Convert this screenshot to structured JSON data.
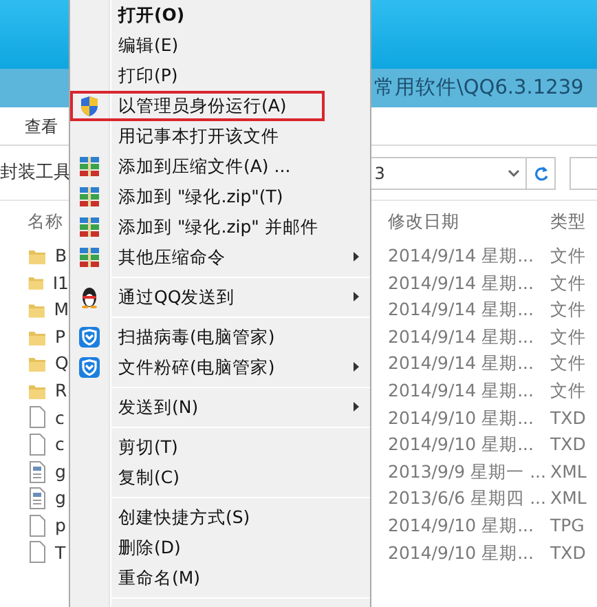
{
  "explorer": {
    "address": "常用软件\\QQ6.3.1239",
    "ribbon_tab": "查看",
    "ribbon_group": "封装工具",
    "path_box": "3",
    "columns": [
      "名称",
      "修改日期",
      "类型"
    ],
    "rows": [
      {
        "name": "B",
        "kind": "folder",
        "date": "2014/9/14 星期...",
        "type": "文件"
      },
      {
        "name": "I1",
        "kind": "folder",
        "date": "2014/9/14 星期...",
        "type": "文件"
      },
      {
        "name": "M",
        "kind": "folder",
        "date": "2014/9/14 星期...",
        "type": "文件"
      },
      {
        "name": "P",
        "kind": "folder",
        "date": "2014/9/14 星期...",
        "type": "文件"
      },
      {
        "name": "Q",
        "kind": "folder",
        "date": "2014/9/14 星期...",
        "type": "文件"
      },
      {
        "name": "R",
        "kind": "folder",
        "date": "2014/9/14 星期...",
        "type": "文件"
      },
      {
        "name": "c",
        "kind": "file",
        "date": "2014/9/10 星期...",
        "type": "TXD"
      },
      {
        "name": "c",
        "kind": "file",
        "date": "2014/9/10 星期...",
        "type": "TXD"
      },
      {
        "name": "g",
        "kind": "xml",
        "date": "2013/9/9 星期一 ...",
        "type": "XML"
      },
      {
        "name": "g",
        "kind": "xml",
        "date": "2013/6/6 星期四 ...",
        "type": "XML"
      },
      {
        "name": "p",
        "kind": "file",
        "date": "2014/9/10 星期...",
        "type": "TPG"
      },
      {
        "name": "T",
        "kind": "file",
        "date": "2014/9/10 星期...",
        "type": "TXD"
      }
    ]
  },
  "context_menu": {
    "items": [
      {
        "kind": "item",
        "label": "打开(O)",
        "bold": true,
        "submenu": false,
        "highlighted": false
      },
      {
        "kind": "item",
        "label": "编辑(E)",
        "bold": false,
        "submenu": false,
        "highlighted": false
      },
      {
        "kind": "item",
        "label": "打印(P)",
        "bold": false,
        "submenu": false,
        "highlighted": false
      },
      {
        "kind": "shield",
        "label": "以管理员身份运行(A)",
        "bold": false,
        "submenu": false,
        "highlighted": true
      },
      {
        "kind": "item",
        "label": "用记事本打开该文件",
        "bold": false,
        "submenu": false,
        "highlighted": false
      },
      {
        "kind": "archive",
        "label": "添加到压缩文件(A) ...",
        "bold": false,
        "submenu": false,
        "highlighted": false
      },
      {
        "kind": "archive",
        "label": "添加到 \"绿化.zip\"(T)",
        "bold": false,
        "submenu": false,
        "highlighted": false
      },
      {
        "kind": "archive",
        "label": "添加到 \"绿化.zip\" 并邮件",
        "bold": false,
        "submenu": false,
        "highlighted": false
      },
      {
        "kind": "archive",
        "label": "其他压缩命令",
        "bold": false,
        "submenu": true,
        "highlighted": false
      },
      {
        "kind": "separator"
      },
      {
        "kind": "penguin",
        "label": "通过QQ发送到",
        "bold": false,
        "submenu": true,
        "highlighted": false
      },
      {
        "kind": "separator"
      },
      {
        "kind": "guard",
        "label": "扫描病毒(电脑管家)",
        "bold": false,
        "submenu": false,
        "highlighted": false
      },
      {
        "kind": "guard",
        "label": "文件粉碎(电脑管家)",
        "bold": false,
        "submenu": true,
        "highlighted": false
      },
      {
        "kind": "separator"
      },
      {
        "kind": "item",
        "label": "发送到(N)",
        "bold": false,
        "submenu": true,
        "highlighted": false
      },
      {
        "kind": "separator"
      },
      {
        "kind": "item",
        "label": "剪切(T)",
        "bold": false,
        "submenu": false,
        "highlighted": false
      },
      {
        "kind": "item",
        "label": "复制(C)",
        "bold": false,
        "submenu": false,
        "highlighted": false
      },
      {
        "kind": "separator"
      },
      {
        "kind": "item",
        "label": "创建快捷方式(S)",
        "bold": false,
        "submenu": false,
        "highlighted": false
      },
      {
        "kind": "item",
        "label": "删除(D)",
        "bold": false,
        "submenu": false,
        "highlighted": false
      },
      {
        "kind": "item",
        "label": "重命名(M)",
        "bold": false,
        "submenu": false,
        "highlighted": false
      },
      {
        "kind": "separator"
      }
    ]
  }
}
